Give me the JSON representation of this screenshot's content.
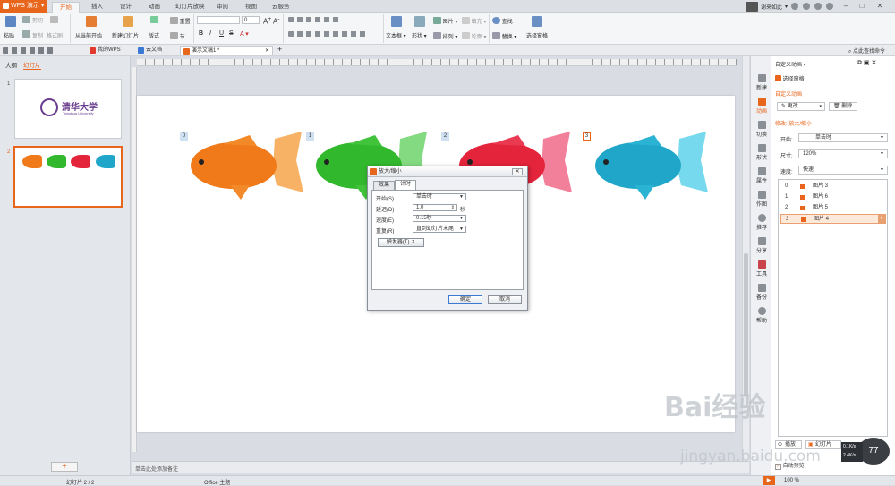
{
  "app": {
    "name": "WPS 演示"
  },
  "menu_tabs": [
    "开始",
    "插入",
    "设计",
    "动画",
    "幻灯片放映",
    "审阅",
    "视图",
    "云服务"
  ],
  "active_menu_tab": "开始",
  "user": {
    "name": "谢来如此"
  },
  "ribbon": {
    "paste": "粘贴",
    "cut": "剪切",
    "copy": "复制",
    "format_painter": "格式刷",
    "from_current": "从当前开始",
    "new_slide": "新建幻灯片",
    "layout": "版式",
    "section": "节",
    "reset": "重置",
    "font_size": "0",
    "text_box": "文本框",
    "shape": "形状",
    "arrange": "排列",
    "picture": "图片",
    "fill": "填充",
    "outline": "轮廓",
    "find": "查找",
    "replace": "替换",
    "select_pane": "选择窗格",
    "font_btns": [
      "B",
      "I",
      "U",
      "S"
    ]
  },
  "doc_tabs": [
    {
      "label": "我的WPS",
      "color": "#e23a2e"
    },
    {
      "label": "云文档",
      "color": "#3a7ad6"
    },
    {
      "label": "演示文稿1 *",
      "color": "#e8651c"
    }
  ],
  "search_placeholder": "点此查找命令",
  "left_panel": {
    "tabs": [
      "大纲",
      "幻灯片"
    ],
    "slide1_text": "清华大学",
    "slide1_sub": "Tsinghua University",
    "nums": [
      "1",
      "2"
    ]
  },
  "slide": {
    "tags": [
      "0",
      "1",
      "2",
      "3"
    ],
    "fish_colors": [
      "#f07a1a",
      "#32b82d",
      "#e4243b",
      "#1fa6c9"
    ]
  },
  "notes_placeholder": "单击此处添加备注",
  "dialog": {
    "title": "放大/缩小",
    "tabs": [
      "效果",
      "计时"
    ],
    "active_tab": "计时",
    "fields": [
      {
        "label": "开始(S)",
        "value": "单击时"
      },
      {
        "label": "延迟(D)",
        "value": "1.0",
        "unit": "秒"
      },
      {
        "label": "速度(E)",
        "value": "0.15秒"
      },
      {
        "label": "重复(R)",
        "value": "直到幻灯片末尾"
      }
    ],
    "trigger": "触发器(T) ⇕",
    "ok": "确定",
    "cancel": "取消"
  },
  "right_strip": [
    "新建",
    "动画",
    "切换",
    "形状",
    "属性",
    "作图",
    "推荐",
    "分享",
    "工具",
    "备份",
    "帮助"
  ],
  "right_panel": {
    "title": "自定义动画",
    "select_pane": "选择窗格",
    "section": "自定义动画",
    "change": "更改",
    "delete": "删除",
    "modify": "修改: 放大/缩小",
    "start_label": "开始:",
    "start_value": "单击时",
    "size_label": "尺寸:",
    "size_value": "120%",
    "speed_label": "速度:",
    "speed_value": "快速",
    "items": [
      {
        "num": "0",
        "name": "图片 3"
      },
      {
        "num": "1",
        "name": "图片 6"
      },
      {
        "num": "2",
        "name": "图片 5"
      },
      {
        "num": "3",
        "name": "图片 4"
      }
    ],
    "play": "播放",
    "slideshow": "幻灯片",
    "autopreview": "自动预览"
  },
  "status": {
    "slide": "幻灯片 2 / 2",
    "theme": "Office 主题",
    "zoom": "100 %"
  },
  "speed_badge": "77",
  "speed_up": "0.1K/s",
  "speed_down": "2.4K/s",
  "watermark": "Bai经验",
  "watermark2": "jingyan.baidu.com"
}
